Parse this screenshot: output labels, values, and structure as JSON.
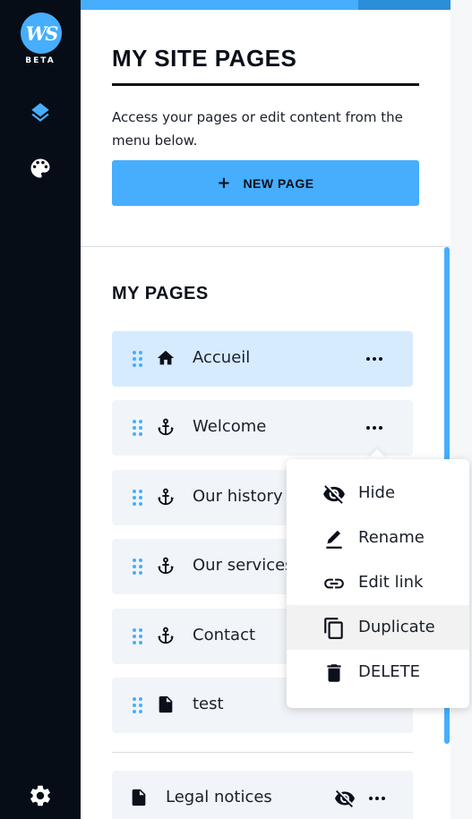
{
  "app": {
    "logo_text": "WS",
    "badge": "BETA"
  },
  "rail": {
    "icons": [
      "layers-icon",
      "palette-icon",
      "settings-icon"
    ]
  },
  "panel": {
    "title": "MY SITE PAGES",
    "description": "Access your pages or edit content from the menu below.",
    "new_page_plus": "+",
    "new_page_label": "NEW PAGE",
    "section_title": "MY PAGES"
  },
  "pages": [
    {
      "label": "Accueil",
      "icon": "home-icon",
      "active": true
    },
    {
      "label": "Welcome",
      "icon": "anchor-icon"
    },
    {
      "label": "Our history",
      "icon": "anchor-icon"
    },
    {
      "label": "Our services",
      "icon": "anchor-icon"
    },
    {
      "label": "Contact",
      "icon": "anchor-icon"
    },
    {
      "label": "test",
      "icon": "page-icon"
    }
  ],
  "legal": {
    "label": "Legal notices",
    "icon": "page-icon",
    "hidden": true
  },
  "context_menu": {
    "items": [
      {
        "label": "Hide",
        "icon": "eye-off-icon"
      },
      {
        "label": "Rename",
        "icon": "pencil-icon"
      },
      {
        "label": "Edit link",
        "icon": "link-icon"
      },
      {
        "label": "Duplicate",
        "icon": "copy-icon",
        "hover": true
      },
      {
        "label": "DELETE",
        "icon": "trash-icon"
      }
    ]
  },
  "colors": {
    "rail_bg": "#060d17",
    "accent": "#46aefc",
    "active_item_bg": "#d6ebfd",
    "item_bg": "#f1f4f8"
  }
}
